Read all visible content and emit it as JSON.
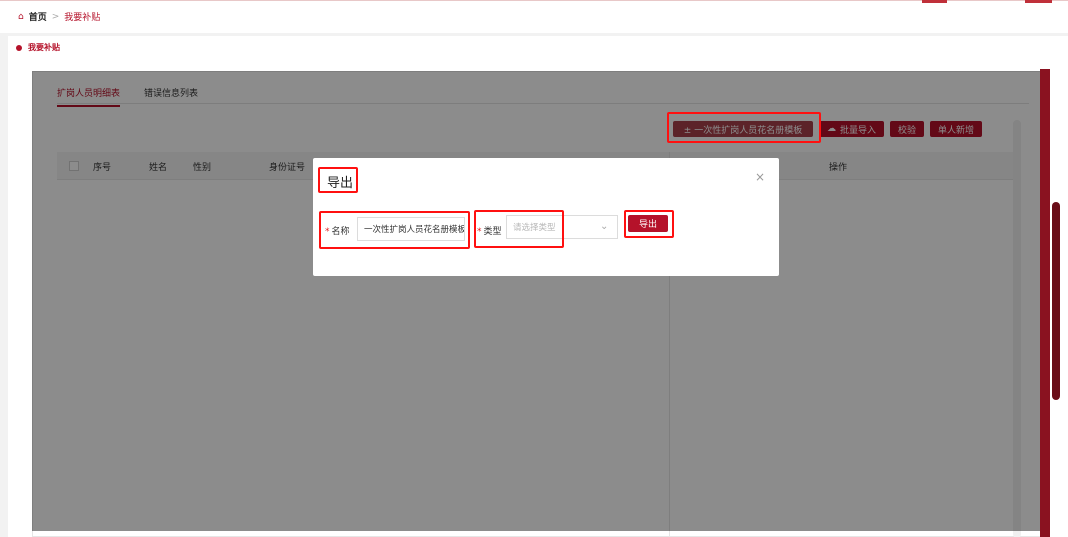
{
  "breadcrumb": {
    "home": "首页",
    "separator": ">",
    "current": "我要补贴"
  },
  "page_title": "我要补贴",
  "tabs": [
    {
      "label": "扩岗人员明细表",
      "active": true
    },
    {
      "label": "错误信息列表",
      "active": false
    }
  ],
  "toolbar": {
    "template_button": "± 一次性扩岗人员花名册模板",
    "batch_import": "批量导入",
    "validate": "校验",
    "single_add": "单人新增"
  },
  "table": {
    "columns": [
      "序号",
      "姓名",
      "性别",
      "身份证号",
      "操作"
    ]
  },
  "dialog": {
    "title": "导出",
    "close": "×",
    "name_label": "名称",
    "name_value": "一次性扩岗人员花名册模板",
    "type_label": "类型",
    "type_placeholder": "请选择类型",
    "export_button": "导出"
  },
  "colors": {
    "brand": "#b5122a",
    "highlight": "#ff1010"
  }
}
